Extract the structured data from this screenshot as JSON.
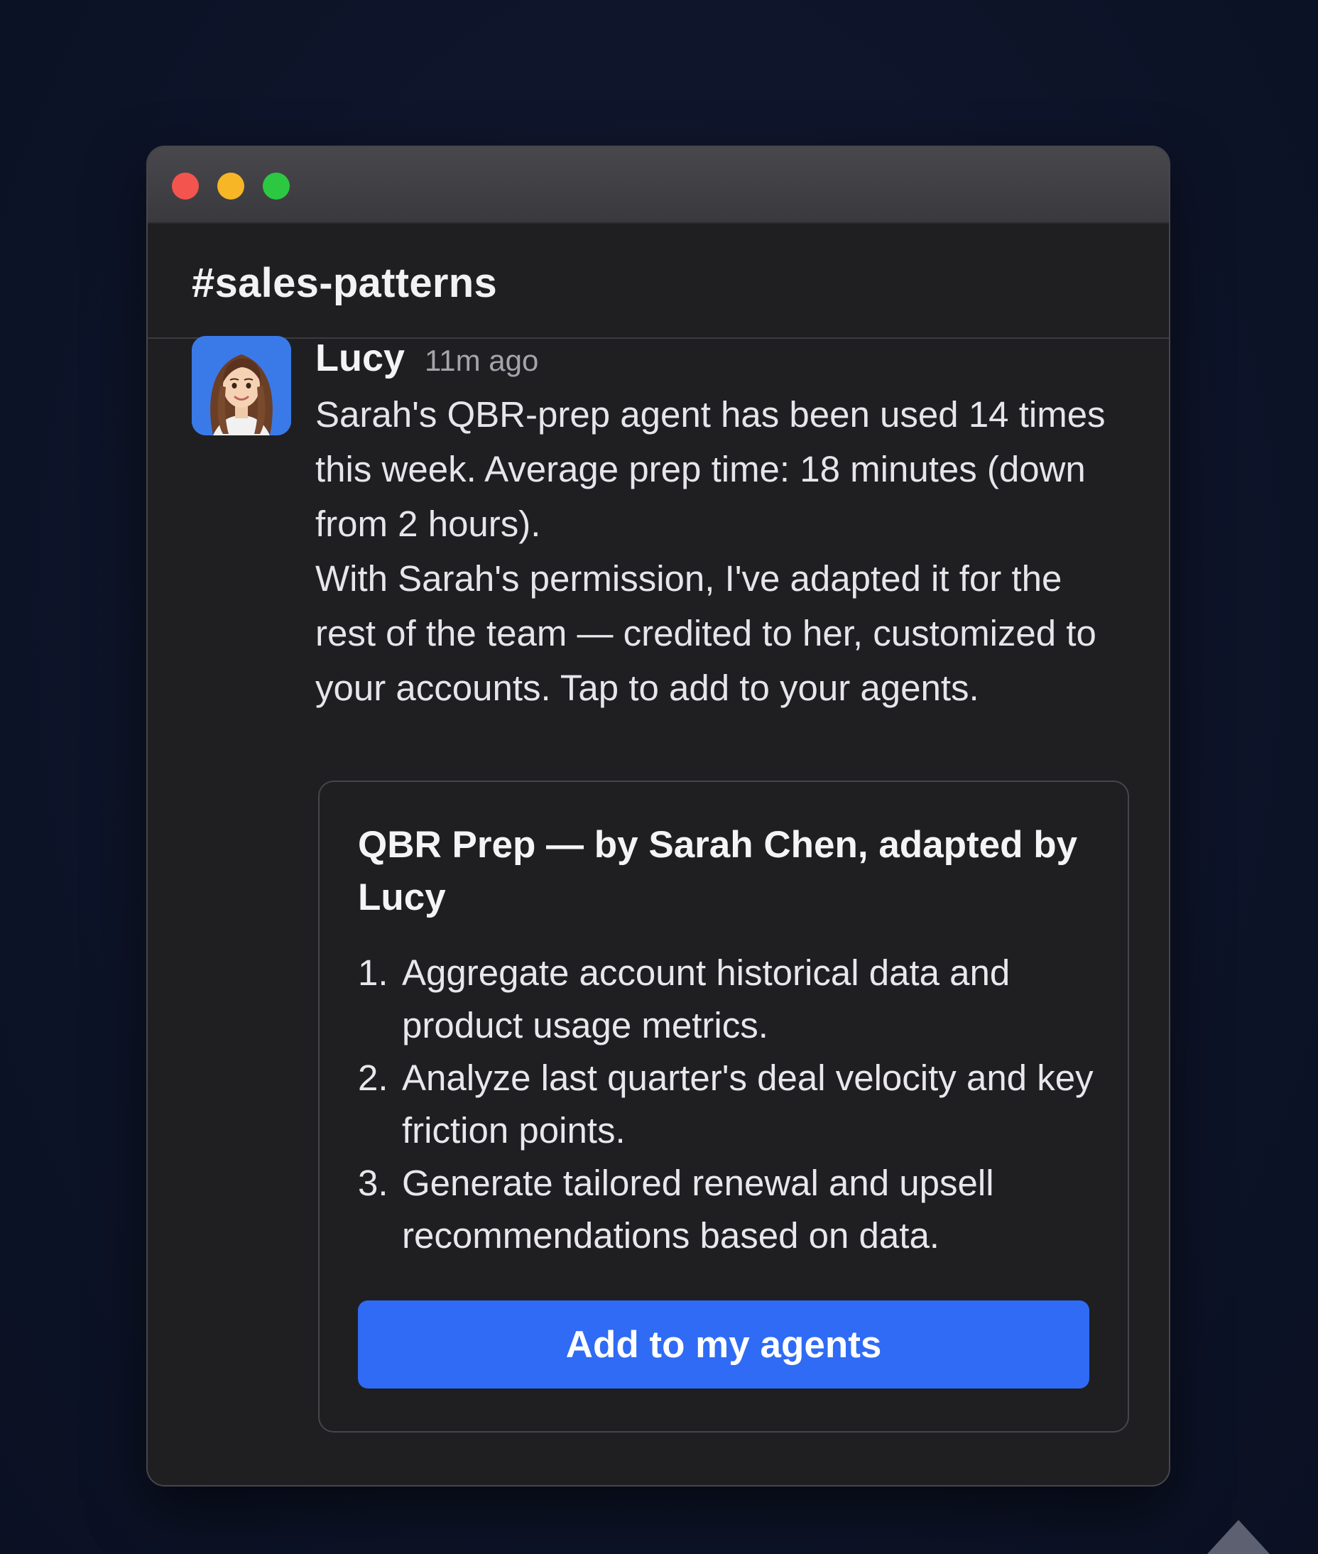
{
  "channel": {
    "name": "#sales-patterns"
  },
  "message": {
    "author": "Lucy",
    "time": "11m ago",
    "paragraphs": [
      "Sarah's QBR-prep agent has been used 14 times this week. Average prep time: 18 minutes (down from 2 hours).",
      "With Sarah's permission, I've adapted it for the rest of the team — credited to her, customized to your accounts. Tap to add to your agents."
    ]
  },
  "card": {
    "title": "QBR Prep — by Sarah Chen, adapted by Lucy",
    "steps": [
      {
        "num": "1.",
        "text": "Aggregate account historical data and product usage metrics."
      },
      {
        "num": "2.",
        "text": "Analyze last quarter's deal velocity and key friction points."
      },
      {
        "num": "3.",
        "text": "Generate tailored renewal and upsell recommendations based on data."
      }
    ],
    "button_label": "Add to my agents"
  },
  "colors": {
    "accent": "#2f6bf4",
    "traffic_red": "#f3544d",
    "traffic_yellow": "#f6b626",
    "traffic_green": "#2cc841"
  }
}
